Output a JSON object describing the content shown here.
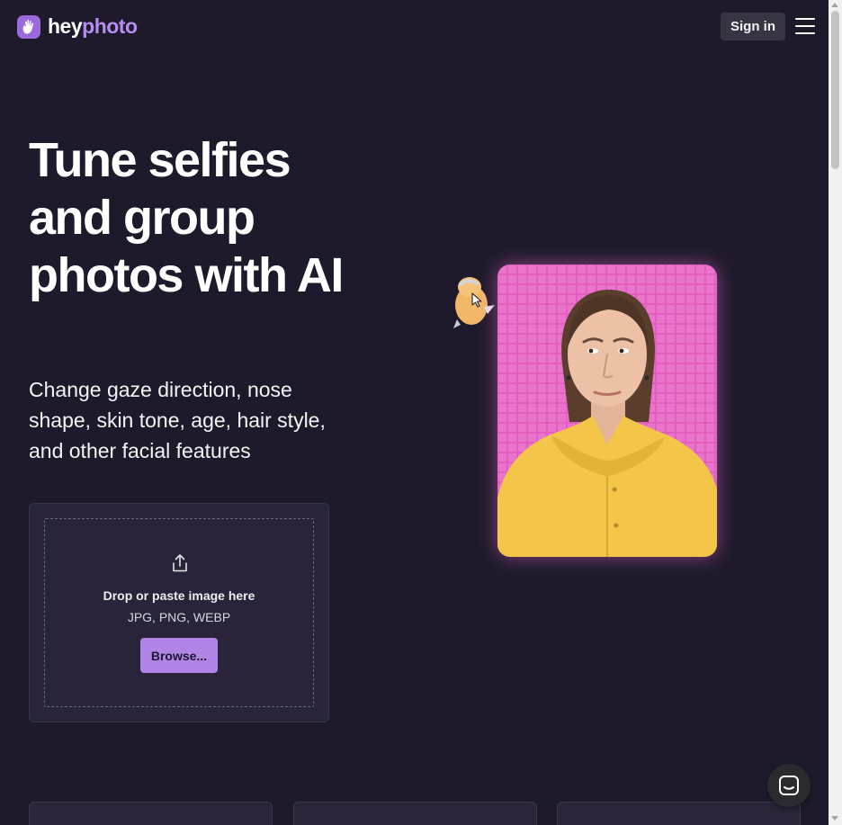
{
  "header": {
    "logo": {
      "word1": "hey",
      "word2": "photo",
      "icon": "waving-hand-icon"
    },
    "signin_label": "Sign in",
    "menu_icon": "hamburger-menu-icon"
  },
  "hero": {
    "headline": "Tune selfies and group photos with AI",
    "subheadline": "Change gaze direction, nose shape, skin tone, age, hair style, and other facial features"
  },
  "upload": {
    "icon": "upload-icon",
    "drop_text": "Drop or paste image here",
    "formats": "JPG, PNG, WEBP",
    "browse_label": "Browse..."
  },
  "illustration": {
    "photo": "woman-in-yellow-jacket-portrait",
    "mascot": "bird-mascot-with-cursor"
  },
  "chat": {
    "icon": "chat-support-icon"
  },
  "colors": {
    "background": "#1e1a2b",
    "accent": "#b185e6",
    "logo_accent": "#b78cf0",
    "card_background": "#292439",
    "photo_background": "#e35fbf",
    "jacket": "#f3c64a"
  }
}
